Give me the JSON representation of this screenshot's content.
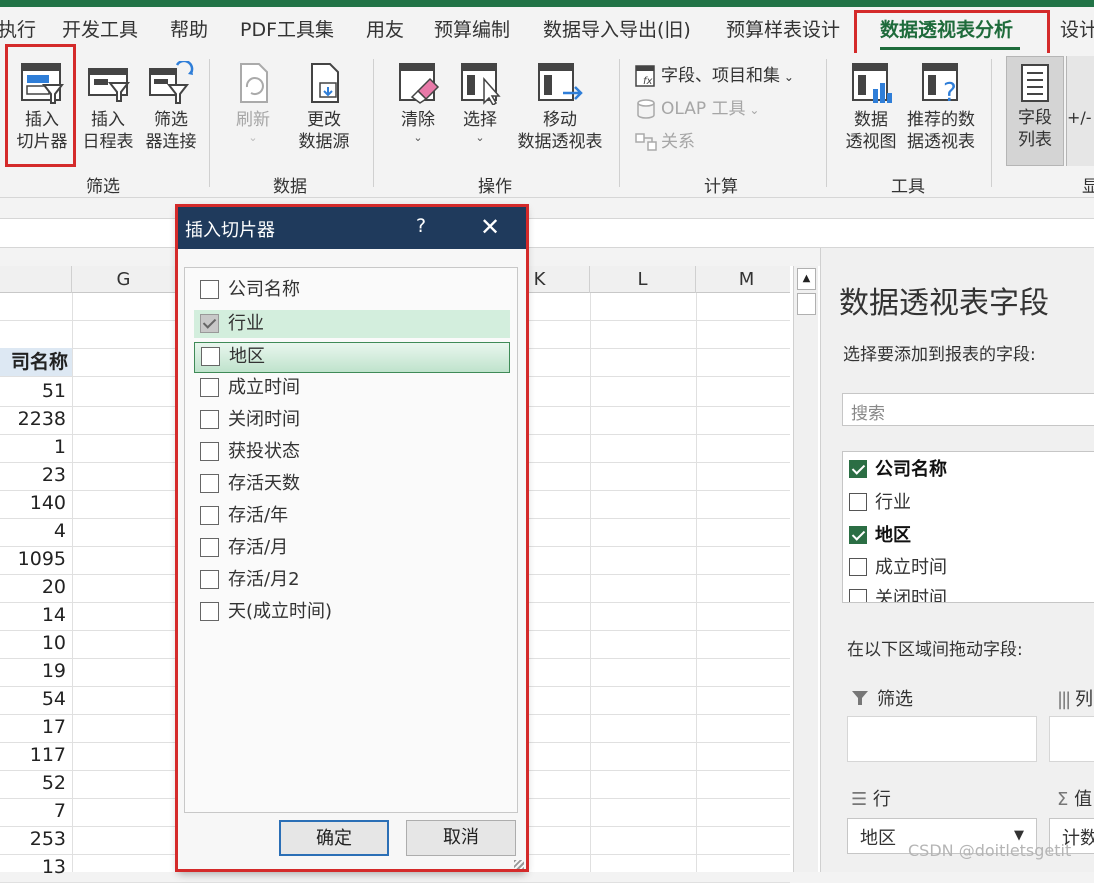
{
  "menu": {
    "items": [
      "执行",
      "开发工具",
      "帮助",
      "PDF工具集",
      "用友",
      "预算编制",
      "数据导入导出(旧)",
      "预算样表设计",
      "数据透视表分析",
      "设计"
    ],
    "active_index": 8
  },
  "ribbon": {
    "insert_slicer": "插入\n切片器",
    "insert_timeline": "插入\n日程表",
    "filter_connections": "筛选\n器连接",
    "group_filter": "筛选",
    "refresh": "刷新",
    "change_source": "更改\n数据源",
    "group_data": "数据",
    "clear": "清除",
    "select": "选择",
    "move_pivot": "移动\n数据透视表",
    "group_actions": "操作",
    "fields_items_sets": "字段、项目和集",
    "olap_tools": "OLAP 工具",
    "relationships": "关系",
    "group_calc": "计算",
    "pivot_chart": "数据\n透视图",
    "recommended_pivot": "推荐的数\n据透视表",
    "group_tools": "工具",
    "field_list": "字段\n列表",
    "plus_minus": "+/-",
    "group_show_partial": "显"
  },
  "sheet": {
    "columns": [
      "G",
      "K",
      "L",
      "M"
    ],
    "header_cell": "司名称",
    "values": [
      "51",
      "2238",
      "1",
      "23",
      "140",
      "4",
      "1095",
      "20",
      "14",
      "10",
      "19",
      "54",
      "17",
      "117",
      "52",
      "7",
      "253",
      "13"
    ]
  },
  "dialog": {
    "title": "插入切片器",
    "help": "?",
    "close": "✕",
    "fields": [
      {
        "label": "公司名称",
        "state": "unchecked"
      },
      {
        "label": "行业",
        "state": "grey-checked"
      },
      {
        "label": "地区",
        "state": "focused"
      },
      {
        "label": "成立时间",
        "state": "unchecked"
      },
      {
        "label": "关闭时间",
        "state": "unchecked"
      },
      {
        "label": "获投状态",
        "state": "unchecked"
      },
      {
        "label": "存活天数",
        "state": "unchecked"
      },
      {
        "label": "存活/年",
        "state": "unchecked"
      },
      {
        "label": "存活/月",
        "state": "unchecked"
      },
      {
        "label": "存活/月2",
        "state": "unchecked"
      },
      {
        "label": "天(成立时间)",
        "state": "unchecked"
      }
    ],
    "ok": "确定",
    "cancel": "取消"
  },
  "pane": {
    "title": "数据透视表字段",
    "subtitle": "选择要添加到报表的字段:",
    "search_placeholder": "搜索",
    "fields": [
      {
        "label": "公司名称",
        "checked": true
      },
      {
        "label": "行业",
        "checked": false
      },
      {
        "label": "地区",
        "checked": true
      },
      {
        "label": "成立时间",
        "checked": false
      },
      {
        "label": "关闭时间",
        "checked": false
      }
    ],
    "drag_label": "在以下区域间拖动字段:",
    "filters_label": "筛选",
    "columns_label": "列",
    "rows_label": "行",
    "values_label": "值",
    "rows_value": "地区",
    "values_value": "计数"
  },
  "watermark": "CSDN @doitletsgetit",
  "colors": {
    "accent_green": "#1e6b3b",
    "dialog_title_bg": "#1f3a5c",
    "annotation_red": "#d42a2a"
  }
}
